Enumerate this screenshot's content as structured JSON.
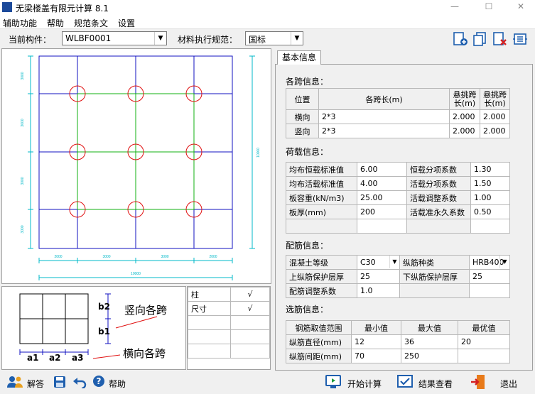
{
  "window": {
    "title": "无梁楼盖有限元计算 8.1",
    "minimize": "—",
    "maximize": "☐",
    "close": "✕"
  },
  "menu": [
    "辅助功能",
    "帮助",
    "规范条文",
    "设置"
  ],
  "toolbar": {
    "component_label": "当前构件：",
    "component_value": "WLBF0001",
    "standard_label": "材料执行规范：",
    "standard_value": "国标",
    "icons": [
      "add-component-icon",
      "copy-component-icon",
      "delete-component-icon",
      "export-icon"
    ]
  },
  "drawing": {
    "left_dims": [
      "3000",
      "3000",
      "3000",
      "3000"
    ],
    "right_total": "10000",
    "bottom_dims": [
      "2000",
      "3000",
      "3000",
      "2000"
    ],
    "bottom_total": "10000"
  },
  "legend": {
    "b2": "b2",
    "b1": "b1",
    "vertical_label": "竖向各跨",
    "a1": "a1",
    "a2": "a2",
    "a3": "a3",
    "horizontal_label": "横向各跨"
  },
  "checks": [
    {
      "label": "柱",
      "mark": "√"
    },
    {
      "label": "尺寸",
      "mark": "√"
    }
  ],
  "tab": "基本信息",
  "spans": {
    "title": "各跨信息：",
    "headers": [
      "位置",
      "各跨长(m)",
      "悬挑跨长(m)",
      "悬挑跨长(m)"
    ],
    "rows": [
      {
        "pos": "横向",
        "len": "2*3",
        "c1": "2.000",
        "c2": "2.000"
      },
      {
        "pos": "竖向",
        "len": "2*3",
        "c1": "2.000",
        "c2": "2.000"
      }
    ]
  },
  "load": {
    "title": "荷载信息：",
    "rows": [
      [
        "均布恒载标准值",
        "6.00",
        "恒载分项系数",
        "1.30"
      ],
      [
        "均布活载标准值",
        "4.00",
        "活载分项系数",
        "1.50"
      ],
      [
        "板容重(kN/m3)",
        "25.00",
        "活载调整系数",
        "1.00"
      ],
      [
        "板厚(mm)",
        "200",
        "活载准永久系数",
        "0.50"
      ],
      [
        "",
        "",
        "",
        ""
      ]
    ]
  },
  "rebar": {
    "title": "配筋信息：",
    "concrete_label": "混凝土等级",
    "concrete_value": "C30",
    "bar_type_label": "纵筋种类",
    "bar_type_value": "HRB400",
    "top_cover_label": "上纵筋保护层厚",
    "top_cover_value": "25",
    "bottom_cover_label": "下纵筋保护层厚",
    "bottom_cover_value": "25",
    "adjust_label": "配筋调整系数",
    "adjust_value": "1.0"
  },
  "selection": {
    "title": "选筋信息：",
    "headers": [
      "钢筋取值范围",
      "最小值",
      "最大值",
      "最优值"
    ],
    "rows": [
      [
        "纵筋直径(mm)",
        "12",
        "36",
        "20"
      ],
      [
        "纵筋间距(mm)",
        "70",
        "250",
        ""
      ]
    ]
  },
  "status": {
    "answer": "解答",
    "help": "帮助",
    "start": "开始计算",
    "view": "结果查看",
    "exit": "退出"
  }
}
